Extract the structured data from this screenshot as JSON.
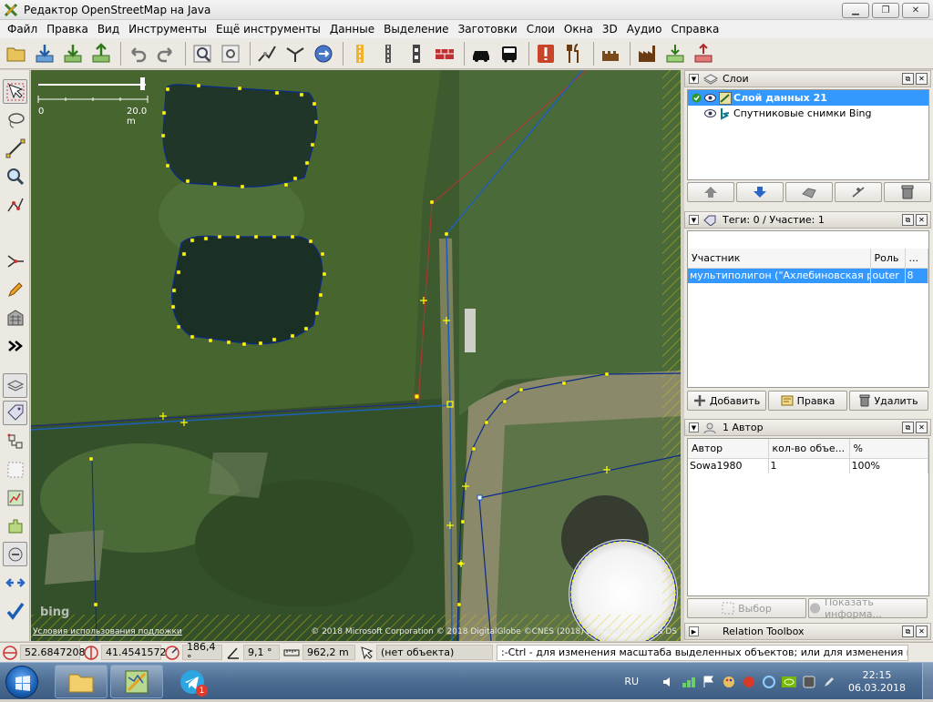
{
  "window": {
    "title": "Редактор OpenStreetMap на Java",
    "icon": "josm-icon",
    "buttons": [
      "minimize-icon",
      "maximize-icon",
      "close-icon"
    ]
  },
  "menu": [
    "Файл",
    "Правка",
    "Вид",
    "Инструменты",
    "Ещё инструменты",
    "Данные",
    "Выделение",
    "Заготовки",
    "Слои",
    "Окна",
    "3D",
    "Аудио",
    "Справка"
  ],
  "toolbar": {
    "icons": [
      "open-icon",
      "download-icon",
      "download-data-icon",
      "upload-icon",
      "undo-icon",
      "redo-icon",
      "zoom-data-icon",
      "preferences-icon",
      "split-way-icon",
      "combine-way-icon",
      "reverse-icon",
      "road-preset-icon",
      "railway-preset-icon",
      "barrier-preset-icon",
      "wall-preset-icon",
      "car-preset-icon",
      "bus-preset-icon",
      "warning-preset-icon",
      "restaurant-preset-icon",
      "castle-preset-icon",
      "industrial-preset-icon",
      "substation-preset-icon",
      "shop-preset-icon"
    ]
  },
  "left_tools": [
    "select-icon",
    "lasso-icon",
    "draw-icon",
    "zoom-icon",
    "delete-icon",
    "parallel-icon",
    "draw-pencil-icon",
    "building-tool-icon",
    "more-tools-icon",
    "layers-toggle-icon",
    "tag-toggle-icon",
    "relation-icon",
    "selection-list-icon",
    "map-paint-icon",
    "plugins-icon",
    "conflict-icon",
    "validator-icon",
    "checkmark-icon"
  ],
  "map": {
    "scale_start": "0",
    "scale_end": "20.0 m",
    "bing_logo": "bing",
    "attribution_link": "Условия использования подложки",
    "copyright": "© 2018 Microsoft Corporation © 2018 DigitalGlobe ©CNES (2018) Distribution Airbus DS"
  },
  "layers_panel": {
    "title": "Слои",
    "items": [
      {
        "name": "Слой данных 21",
        "selected": true,
        "active": true
      },
      {
        "name": "Спутниковые снимки Bing",
        "selected": false,
        "active": false
      }
    ],
    "buttons": [
      "move-up-icon",
      "move-down-icon",
      "merge-icon",
      "visibility-icon",
      "delete-layer-icon"
    ]
  },
  "tags_panel": {
    "title": "Теги: 0 / Участие: 1",
    "columns": [
      "Участник",
      "Роль",
      "..."
    ],
    "rows": [
      {
        "member": "мультиполигон (\"Ахлебиновская ро...",
        "role": "outer",
        "count": "8"
      }
    ],
    "buttons": [
      "Добавить",
      "Правка",
      "Удалить"
    ]
  },
  "authors_panel": {
    "title": "1 Автор",
    "columns": [
      "Автор",
      "кол-во объе...",
      "%"
    ],
    "rows": [
      {
        "author": "Sowa1980",
        "count": "1",
        "percent": "100%"
      }
    ],
    "buttons": [
      "Выбор",
      "Показать информа..."
    ]
  },
  "relation_toolbox": {
    "title": "Relation Toolbox"
  },
  "status": {
    "lat": "52.6847208",
    "lon": "41.4541572",
    "heading": "186,4 °",
    "angle": "9,1 °",
    "distance": "962,2 m",
    "object": "(нет объекта)",
    "hint": ":-Ctrl - для изменения масштаба выделенных объектов; или для изменения выделения"
  },
  "taskbar": {
    "lang": "RU",
    "time": "22:15",
    "date": "06.03.2018",
    "telegram_badge": "1"
  },
  "colors": {
    "selection_blue": "#3399ff",
    "way_line": "#0b2a8a",
    "node_yellow": "#ffff00",
    "relation_red": "#c43030"
  }
}
